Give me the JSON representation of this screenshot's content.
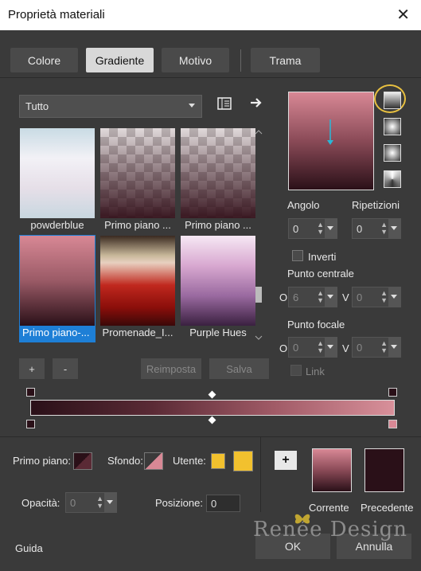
{
  "window": {
    "title": "Proprietà materiali",
    "close": "✕"
  },
  "tabs": [
    {
      "label": "Colore"
    },
    {
      "label": "Gradiente"
    },
    {
      "label": "Motivo"
    },
    {
      "label": "Trama"
    }
  ],
  "category": {
    "selected": "Tutto"
  },
  "gradients": [
    {
      "label": "powderblue"
    },
    {
      "label": "Primo piano ..."
    },
    {
      "label": "Primo piano ..."
    },
    {
      "label": "Primo piano-..."
    },
    {
      "label": "Promenade_I..."
    },
    {
      "label": "Purple Hues"
    }
  ],
  "buttons": {
    "add": "+",
    "remove": "-",
    "reset": "Reimposta",
    "save": "Salva",
    "ok": "OK",
    "cancel": "Annulla",
    "help": "Guida"
  },
  "params": {
    "angle_label": "Angolo",
    "angle_value": "0",
    "repeat_label": "Ripetizioni",
    "repeat_value": "0",
    "invert_label": "Inverti",
    "center_label": "Punto centrale",
    "center_h_prefix": "O",
    "center_h_value": "6",
    "center_v_prefix": "V",
    "center_v_value": "0",
    "focal_label": "Punto focale",
    "focal_h_prefix": "O",
    "focal_h_value": "0",
    "focal_v_prefix": "V",
    "focal_v_value": "0",
    "link_label": "Link"
  },
  "bottom": {
    "foreground_label": "Primo piano:",
    "background_label": "Sfondo:",
    "user_label": "Utente:",
    "opacity_label": "Opacità:",
    "opacity_value": "0",
    "position_label": "Posizione:",
    "position_value": "0",
    "current_label": "Corrente",
    "previous_label": "Precedente",
    "add_swatch": "+"
  },
  "watermark": "Renée Design",
  "colors": {
    "accent": "#1e7fd6",
    "highlight_ring": "#e8c040",
    "user_color": "#f2c12e",
    "previous_color": "#2a1018"
  }
}
